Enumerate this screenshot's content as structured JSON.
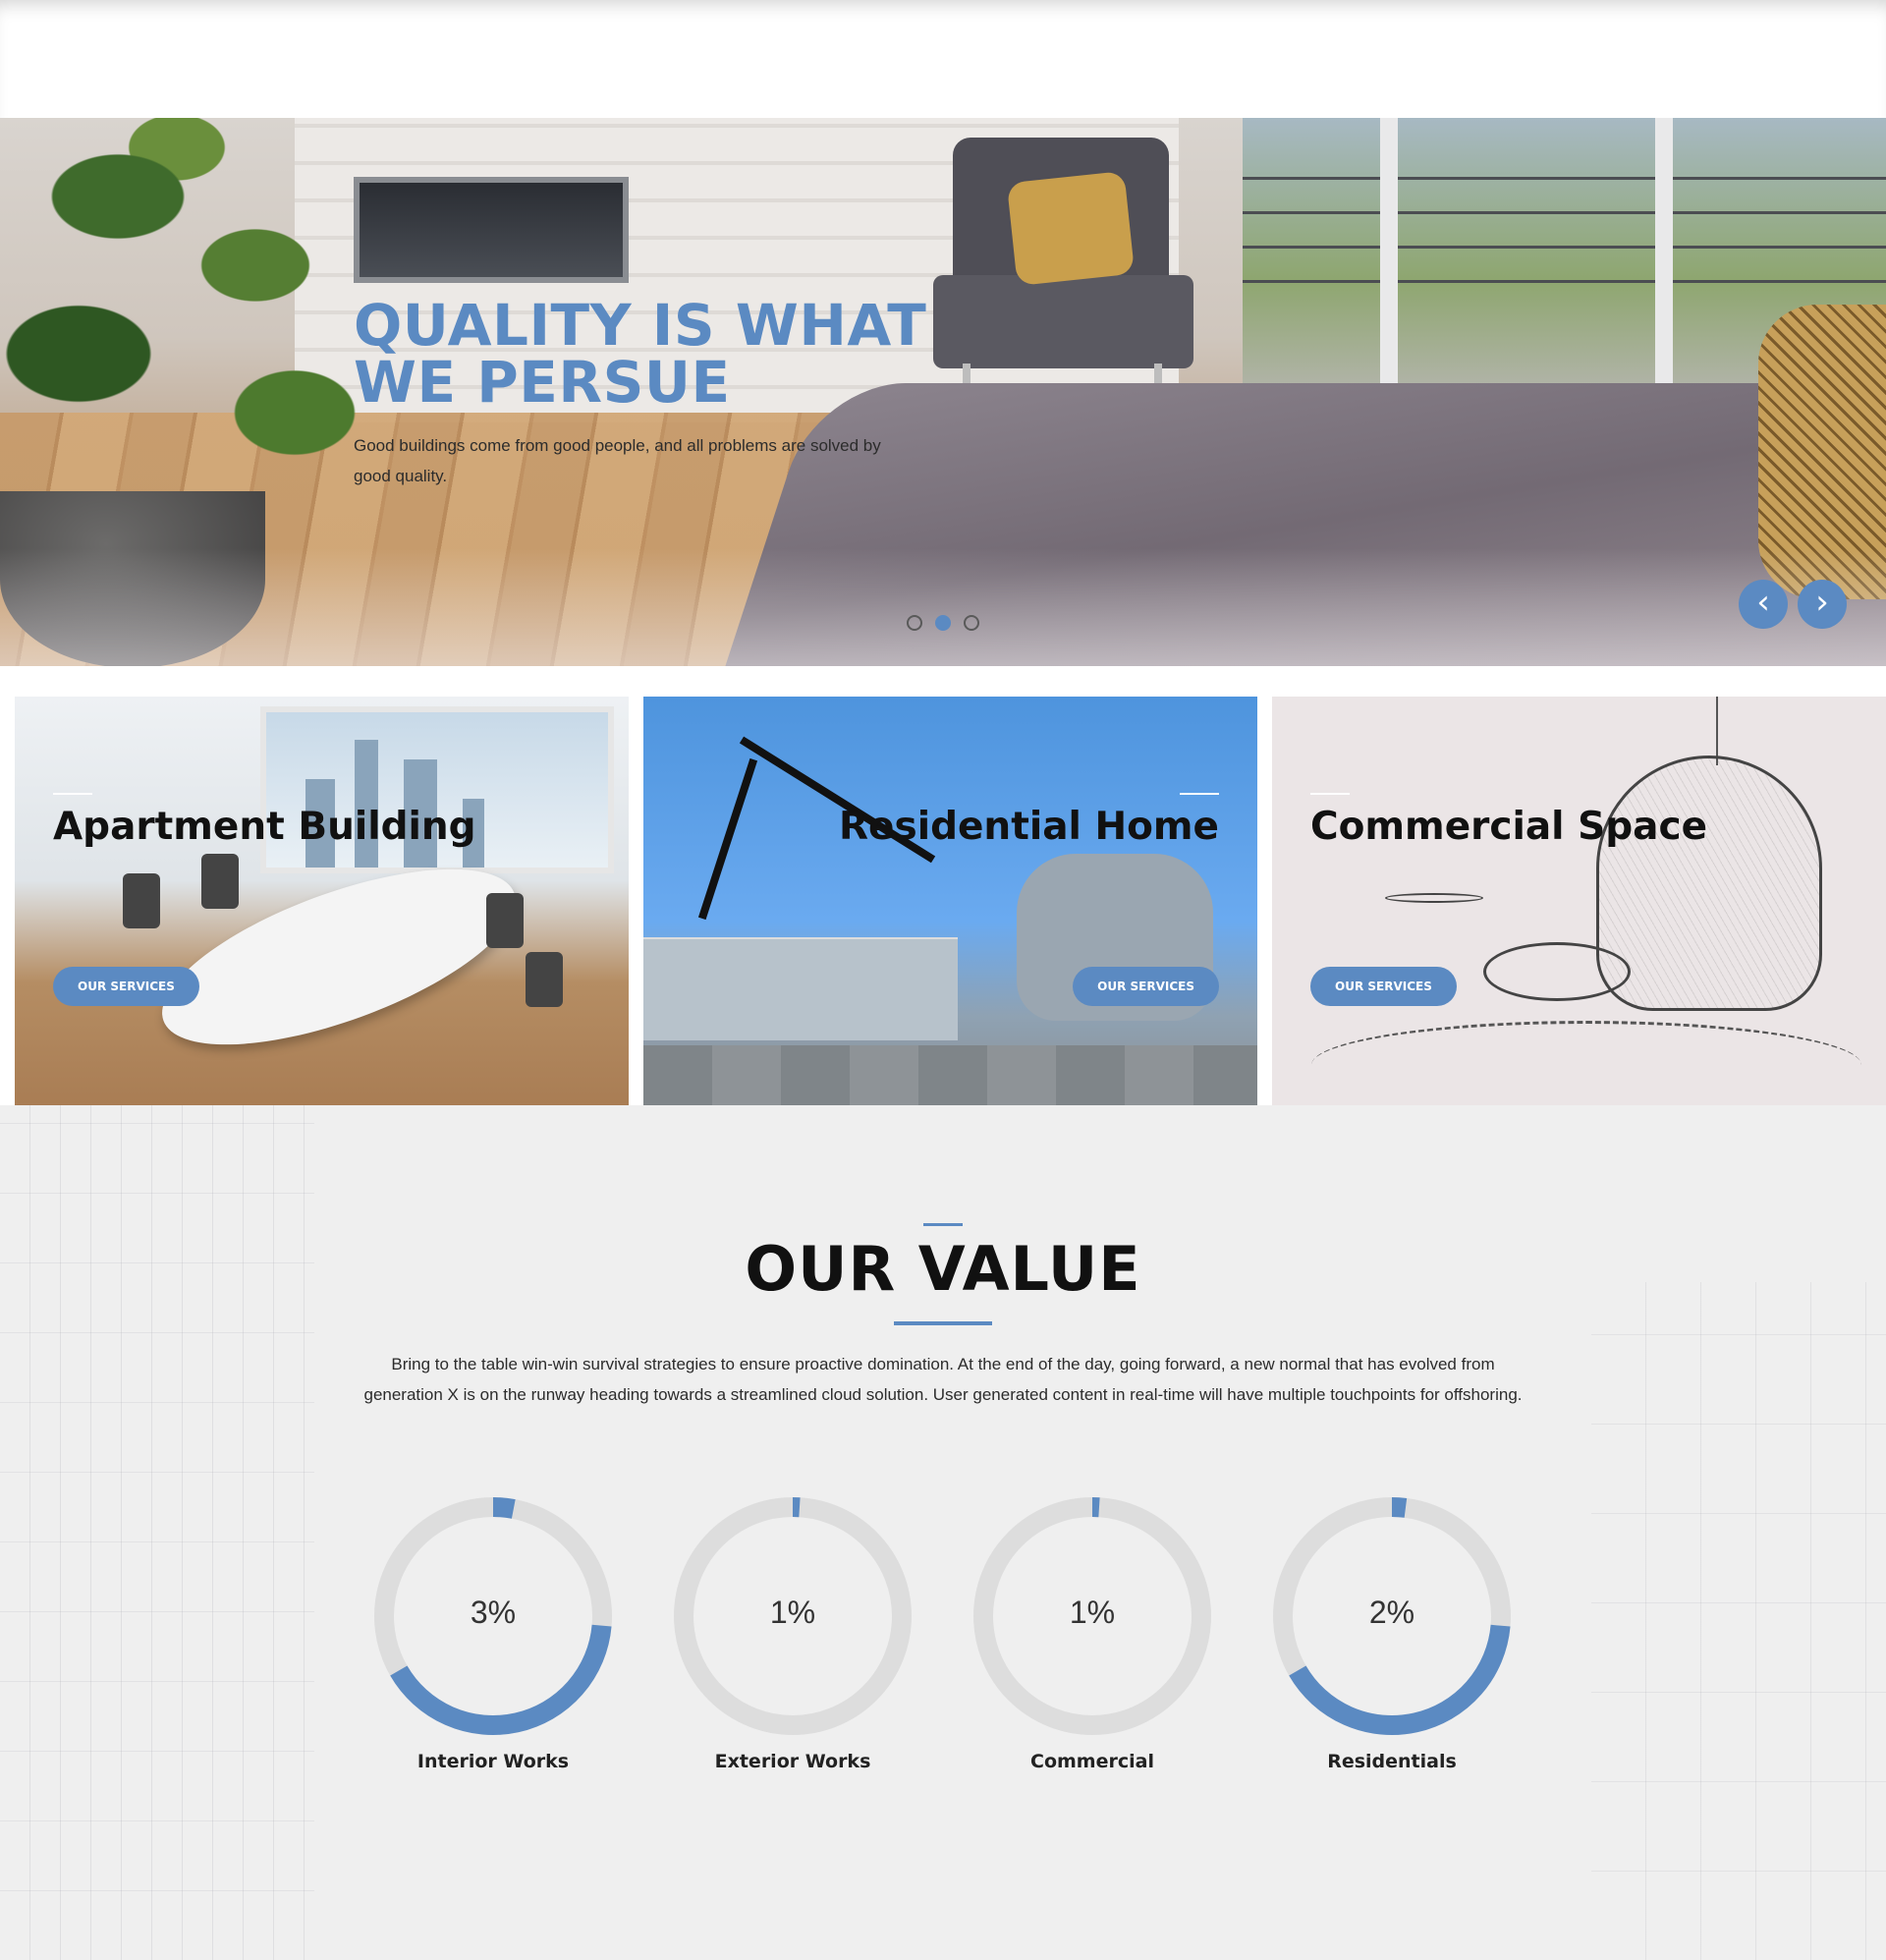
{
  "colors": {
    "accent": "#5b8ac2",
    "track": "#dddddd",
    "section_bg": "#efefef"
  },
  "hero": {
    "title_line1": "QUALITY IS WHAT",
    "title_line2": "WE PERSUE",
    "text": "Good buildings come from good people, and all problems are solved by good quality.",
    "slides": 3,
    "active_slide": 2,
    "prev_icon": "chevron-left-icon",
    "next_icon": "chevron-right-icon"
  },
  "tiles": [
    {
      "title": "Apartment Building",
      "button": "OUR SERVICES",
      "align": "left"
    },
    {
      "title": "Residential Home",
      "button": "OUR SERVICES",
      "align": "right"
    },
    {
      "title": "Commercial Space",
      "button": "OUR SERVICES",
      "align": "left"
    }
  ],
  "value": {
    "title": "OUR VALUE",
    "text": "Bring to the table win-win survival strategies to ensure proactive domination. At the end of the day, going forward, a new normal that has evolved from generation X is on the runway heading towards a streamlined cloud solution. User generated content in real-time will have multiple touchpoints for offshoring.",
    "gauges": [
      {
        "label": "Interior Works",
        "percent_text": "3%",
        "indicator_value": 3,
        "bottom_arc": true
      },
      {
        "label": "Exterior Works",
        "percent_text": "1%",
        "indicator_value": 1,
        "bottom_arc": false
      },
      {
        "label": "Commercial",
        "percent_text": "1%",
        "indicator_value": 1,
        "bottom_arc": false
      },
      {
        "label": "Residentials",
        "percent_text": "2%",
        "indicator_value": 2,
        "bottom_arc": true
      }
    ]
  }
}
